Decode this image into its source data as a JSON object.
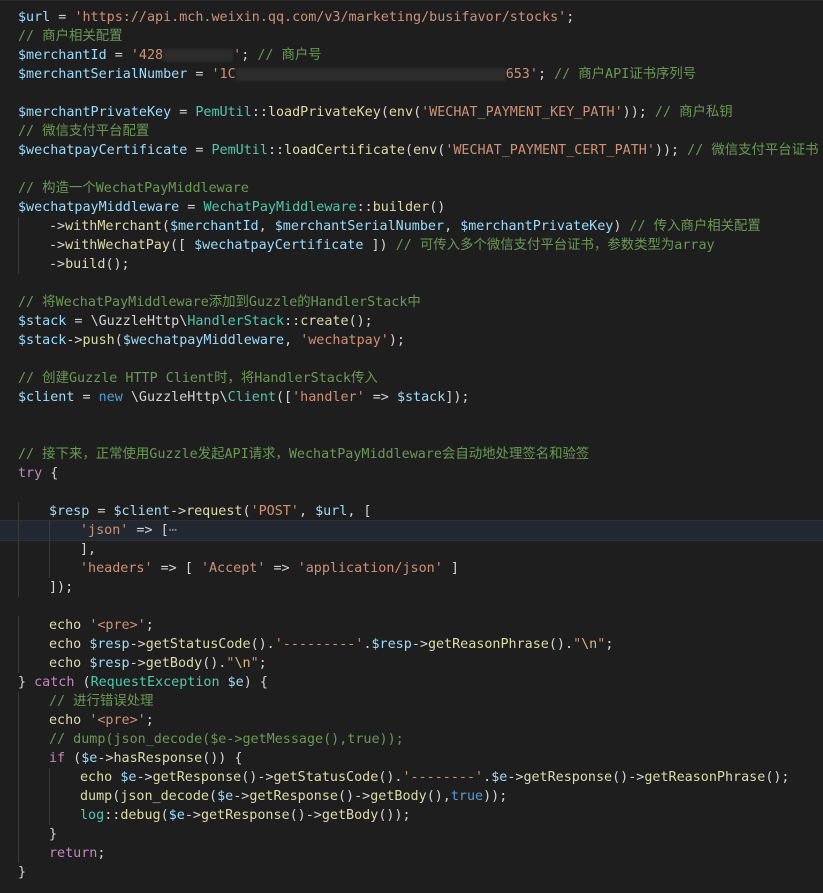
{
  "editor": {
    "language": "PHP",
    "current_line_index": 27,
    "colors": {
      "background": "#1e1e1e",
      "variable": "#9cdcfe",
      "string": "#ce9178",
      "comment": "#6a9955",
      "function": "#dcdcaa",
      "class": "#4ec9b0",
      "control_keyword": "#c586c0",
      "keyword": "#569cd6",
      "plain": "#d4d4d4"
    },
    "lines": [
      {
        "indent": 0,
        "tokens": [
          [
            "v",
            "$url"
          ],
          [
            "o",
            " = "
          ],
          [
            "s",
            "'https://api.mch.weixin.qq.com/v3/marketing/busifavor/stocks'"
          ],
          [
            "p",
            ";"
          ]
        ]
      },
      {
        "indent": 0,
        "tokens": [
          [
            "c",
            "// 商户相关配置"
          ]
        ]
      },
      {
        "indent": 0,
        "tokens": [
          [
            "v",
            "$merchantId"
          ],
          [
            "o",
            " = "
          ],
          [
            "s",
            "'428"
          ],
          [
            "redact",
            "70"
          ],
          [
            "s",
            "'"
          ],
          [
            "p",
            "; "
          ],
          [
            "c",
            "// 商户号"
          ]
        ]
      },
      {
        "indent": 0,
        "tokens": [
          [
            "v",
            "$merchantSerialNumber"
          ],
          [
            "o",
            " = "
          ],
          [
            "s",
            "'1C"
          ],
          [
            "redact",
            "270"
          ],
          [
            "s",
            "653'"
          ],
          [
            "p",
            "; "
          ],
          [
            "c",
            "// 商户API证书序列号"
          ]
        ]
      },
      {
        "indent": 0,
        "tokens": []
      },
      {
        "indent": 0,
        "tokens": [
          [
            "v",
            "$merchantPrivateKey"
          ],
          [
            "o",
            " = "
          ],
          [
            "cl",
            "PemUtil"
          ],
          [
            "o",
            "::"
          ],
          [
            "f",
            "loadPrivateKey"
          ],
          [
            "p",
            "("
          ],
          [
            "f",
            "env"
          ],
          [
            "p",
            "("
          ],
          [
            "s",
            "'WECHAT_PAYMENT_KEY_PATH'"
          ],
          [
            "p",
            "));"
          ],
          [
            "o",
            " "
          ],
          [
            "c",
            "// 商户私钥"
          ]
        ]
      },
      {
        "indent": 0,
        "tokens": [
          [
            "c",
            "// 微信支付平台配置"
          ]
        ]
      },
      {
        "indent": 0,
        "tokens": [
          [
            "v",
            "$wechatpayCertificate"
          ],
          [
            "o",
            " = "
          ],
          [
            "cl",
            "PemUtil"
          ],
          [
            "o",
            "::"
          ],
          [
            "f",
            "loadCertificate"
          ],
          [
            "p",
            "("
          ],
          [
            "f",
            "env"
          ],
          [
            "p",
            "("
          ],
          [
            "s",
            "'WECHAT_PAYMENT_CERT_PATH'"
          ],
          [
            "p",
            "));"
          ],
          [
            "o",
            " "
          ],
          [
            "c",
            "// 微信支付平台证书"
          ]
        ]
      },
      {
        "indent": 0,
        "tokens": []
      },
      {
        "indent": 0,
        "tokens": [
          [
            "c",
            "// 构造一个WechatPayMiddleware"
          ]
        ]
      },
      {
        "indent": 0,
        "tokens": [
          [
            "v",
            "$wechatpayMiddleware"
          ],
          [
            "o",
            " = "
          ],
          [
            "cl",
            "WechatPayMiddleware"
          ],
          [
            "o",
            "::"
          ],
          [
            "f",
            "builder"
          ],
          [
            "p",
            "()"
          ]
        ]
      },
      {
        "indent": 1,
        "tokens": [
          [
            "o",
            "->"
          ],
          [
            "f",
            "withMerchant"
          ],
          [
            "p",
            "("
          ],
          [
            "v",
            "$merchantId"
          ],
          [
            "p",
            ", "
          ],
          [
            "v",
            "$merchantSerialNumber"
          ],
          [
            "p",
            ", "
          ],
          [
            "v",
            "$merchantPrivateKey"
          ],
          [
            "p",
            ")"
          ],
          [
            "o",
            " "
          ],
          [
            "c",
            "// 传入商户相关配置"
          ]
        ]
      },
      {
        "indent": 1,
        "tokens": [
          [
            "o",
            "->"
          ],
          [
            "f",
            "withWechatPay"
          ],
          [
            "p",
            "([ "
          ],
          [
            "v",
            "$wechatpayCertificate"
          ],
          [
            "p",
            " ])"
          ],
          [
            "o",
            " "
          ],
          [
            "c",
            "// 可传入多个微信支付平台证书，参数类型为array"
          ]
        ]
      },
      {
        "indent": 1,
        "tokens": [
          [
            "o",
            "->"
          ],
          [
            "f",
            "build"
          ],
          [
            "p",
            "();"
          ]
        ]
      },
      {
        "indent": 0,
        "tokens": []
      },
      {
        "indent": 0,
        "tokens": [
          [
            "c",
            "// 将WechatPayMiddleware添加到Guzzle的HandlerStack中"
          ]
        ]
      },
      {
        "indent": 0,
        "tokens": [
          [
            "v",
            "$stack"
          ],
          [
            "o",
            " = "
          ],
          [
            "p",
            "\\GuzzleHttp\\"
          ],
          [
            "cl",
            "HandlerStack"
          ],
          [
            "o",
            "::"
          ],
          [
            "f",
            "create"
          ],
          [
            "p",
            "();"
          ]
        ]
      },
      {
        "indent": 0,
        "tokens": [
          [
            "v",
            "$stack"
          ],
          [
            "o",
            "->"
          ],
          [
            "f",
            "push"
          ],
          [
            "p",
            "("
          ],
          [
            "v",
            "$wechatpayMiddleware"
          ],
          [
            "p",
            ", "
          ],
          [
            "s",
            "'wechatpay'"
          ],
          [
            "p",
            ");"
          ]
        ]
      },
      {
        "indent": 0,
        "tokens": []
      },
      {
        "indent": 0,
        "tokens": [
          [
            "c",
            "// 创建Guzzle HTTP Client时，将HandlerStack传入"
          ]
        ]
      },
      {
        "indent": 0,
        "tokens": [
          [
            "v",
            "$client"
          ],
          [
            "o",
            " = "
          ],
          [
            "kb",
            "new"
          ],
          [
            "o",
            " "
          ],
          [
            "p",
            "\\GuzzleHttp\\"
          ],
          [
            "cl",
            "Client"
          ],
          [
            "p",
            "(["
          ],
          [
            "s",
            "'handler'"
          ],
          [
            "o",
            " => "
          ],
          [
            "v",
            "$stack"
          ],
          [
            "p",
            "]);"
          ]
        ]
      },
      {
        "indent": 0,
        "tokens": []
      },
      {
        "indent": 0,
        "tokens": []
      },
      {
        "indent": 0,
        "tokens": [
          [
            "c",
            "// 接下来，正常使用Guzzle发起API请求，WechatPayMiddleware会自动地处理签名和验签"
          ]
        ]
      },
      {
        "indent": 0,
        "tokens": [
          [
            "k",
            "try"
          ],
          [
            "p",
            " {"
          ]
        ]
      },
      {
        "indent": 0,
        "tokens": []
      },
      {
        "indent": 1,
        "tokens": [
          [
            "v",
            "$resp"
          ],
          [
            "o",
            " = "
          ],
          [
            "v",
            "$client"
          ],
          [
            "o",
            "->"
          ],
          [
            "f",
            "request"
          ],
          [
            "p",
            "("
          ],
          [
            "s",
            "'POST'"
          ],
          [
            "p",
            ", "
          ],
          [
            "v",
            "$url"
          ],
          [
            "p",
            ", ["
          ]
        ]
      },
      {
        "indent": 2,
        "tokens": [
          [
            "s",
            "'json'"
          ],
          [
            "o",
            " => "
          ],
          [
            "p",
            "["
          ],
          [
            "fold",
            "⋯"
          ]
        ]
      },
      {
        "indent": 2,
        "tokens": [
          [
            "p",
            "],"
          ]
        ]
      },
      {
        "indent": 2,
        "tokens": [
          [
            "s",
            "'headers'"
          ],
          [
            "o",
            " => "
          ],
          [
            "p",
            "[ "
          ],
          [
            "s",
            "'Accept'"
          ],
          [
            "o",
            " => "
          ],
          [
            "s",
            "'application/json'"
          ],
          [
            "p",
            " ]"
          ]
        ]
      },
      {
        "indent": 1,
        "tokens": [
          [
            "p",
            "]);"
          ]
        ]
      },
      {
        "indent": 0,
        "tokens": []
      },
      {
        "indent": 1,
        "tokens": [
          [
            "f",
            "echo"
          ],
          [
            "o",
            " "
          ],
          [
            "s",
            "'<pre>'"
          ],
          [
            "p",
            ";"
          ]
        ]
      },
      {
        "indent": 1,
        "tokens": [
          [
            "f",
            "echo"
          ],
          [
            "o",
            " "
          ],
          [
            "v",
            "$resp"
          ],
          [
            "o",
            "->"
          ],
          [
            "f",
            "getStatusCode"
          ],
          [
            "p",
            "()."
          ],
          [
            "s",
            "'---------'"
          ],
          [
            "p",
            "."
          ],
          [
            "v",
            "$resp"
          ],
          [
            "o",
            "->"
          ],
          [
            "f",
            "getReasonPhrase"
          ],
          [
            "p",
            "()."
          ],
          [
            "s",
            "\""
          ],
          [
            "e",
            "\\n"
          ],
          [
            "s",
            "\""
          ],
          [
            "p",
            ";"
          ]
        ]
      },
      {
        "indent": 1,
        "tokens": [
          [
            "f",
            "echo"
          ],
          [
            "o",
            " "
          ],
          [
            "v",
            "$resp"
          ],
          [
            "o",
            "->"
          ],
          [
            "f",
            "getBody"
          ],
          [
            "p",
            "()."
          ],
          [
            "s",
            "\""
          ],
          [
            "e",
            "\\n"
          ],
          [
            "s",
            "\""
          ],
          [
            "p",
            ";"
          ]
        ]
      },
      {
        "indent": 0,
        "tokens": [
          [
            "p",
            "} "
          ],
          [
            "k",
            "catch"
          ],
          [
            "p",
            " ("
          ],
          [
            "cl",
            "RequestException"
          ],
          [
            "o",
            " "
          ],
          [
            "v",
            "$e"
          ],
          [
            "p",
            ") {"
          ]
        ]
      },
      {
        "indent": 1,
        "tokens": [
          [
            "c",
            "// 进行错误处理"
          ]
        ]
      },
      {
        "indent": 1,
        "tokens": [
          [
            "f",
            "echo"
          ],
          [
            "o",
            " "
          ],
          [
            "s",
            "'<pre>'"
          ],
          [
            "p",
            ";"
          ]
        ]
      },
      {
        "indent": 1,
        "tokens": [
          [
            "c",
            "// dump(json_decode($e->getMessage(),true));"
          ]
        ]
      },
      {
        "indent": 1,
        "tokens": [
          [
            "k",
            "if"
          ],
          [
            "p",
            " ("
          ],
          [
            "v",
            "$e"
          ],
          [
            "o",
            "->"
          ],
          [
            "f",
            "hasResponse"
          ],
          [
            "p",
            "()) {"
          ]
        ]
      },
      {
        "indent": 2,
        "tokens": [
          [
            "f",
            "echo"
          ],
          [
            "o",
            " "
          ],
          [
            "v",
            "$e"
          ],
          [
            "o",
            "->"
          ],
          [
            "f",
            "getResponse"
          ],
          [
            "p",
            "()"
          ],
          [
            "o",
            "->"
          ],
          [
            "f",
            "getStatusCode"
          ],
          [
            "p",
            "()."
          ],
          [
            "s",
            "'--------'"
          ],
          [
            "p",
            "."
          ],
          [
            "v",
            "$e"
          ],
          [
            "o",
            "->"
          ],
          [
            "f",
            "getResponse"
          ],
          [
            "p",
            "()"
          ],
          [
            "o",
            "->"
          ],
          [
            "f",
            "getReasonPhrase"
          ],
          [
            "p",
            "();"
          ]
        ]
      },
      {
        "indent": 2,
        "tokens": [
          [
            "f",
            "dump"
          ],
          [
            "p",
            "("
          ],
          [
            "f",
            "json_decode"
          ],
          [
            "p",
            "("
          ],
          [
            "v",
            "$e"
          ],
          [
            "o",
            "->"
          ],
          [
            "f",
            "getResponse"
          ],
          [
            "p",
            "()"
          ],
          [
            "o",
            "->"
          ],
          [
            "f",
            "getBody"
          ],
          [
            "p",
            "(),"
          ],
          [
            "kb",
            "true"
          ],
          [
            "p",
            "));"
          ]
        ]
      },
      {
        "indent": 2,
        "tokens": [
          [
            "cl",
            "log"
          ],
          [
            "o",
            "::"
          ],
          [
            "f",
            "debug"
          ],
          [
            "p",
            "("
          ],
          [
            "v",
            "$e"
          ],
          [
            "o",
            "->"
          ],
          [
            "f",
            "getResponse"
          ],
          [
            "p",
            "()"
          ],
          [
            "o",
            "->"
          ],
          [
            "f",
            "getBody"
          ],
          [
            "p",
            "());"
          ]
        ]
      },
      {
        "indent": 1,
        "tokens": [
          [
            "p",
            "}"
          ]
        ]
      },
      {
        "indent": 1,
        "tokens": [
          [
            "k",
            "return"
          ],
          [
            "p",
            ";"
          ]
        ]
      },
      {
        "indent": 0,
        "tokens": [
          [
            "p",
            "}"
          ]
        ]
      }
    ]
  }
}
